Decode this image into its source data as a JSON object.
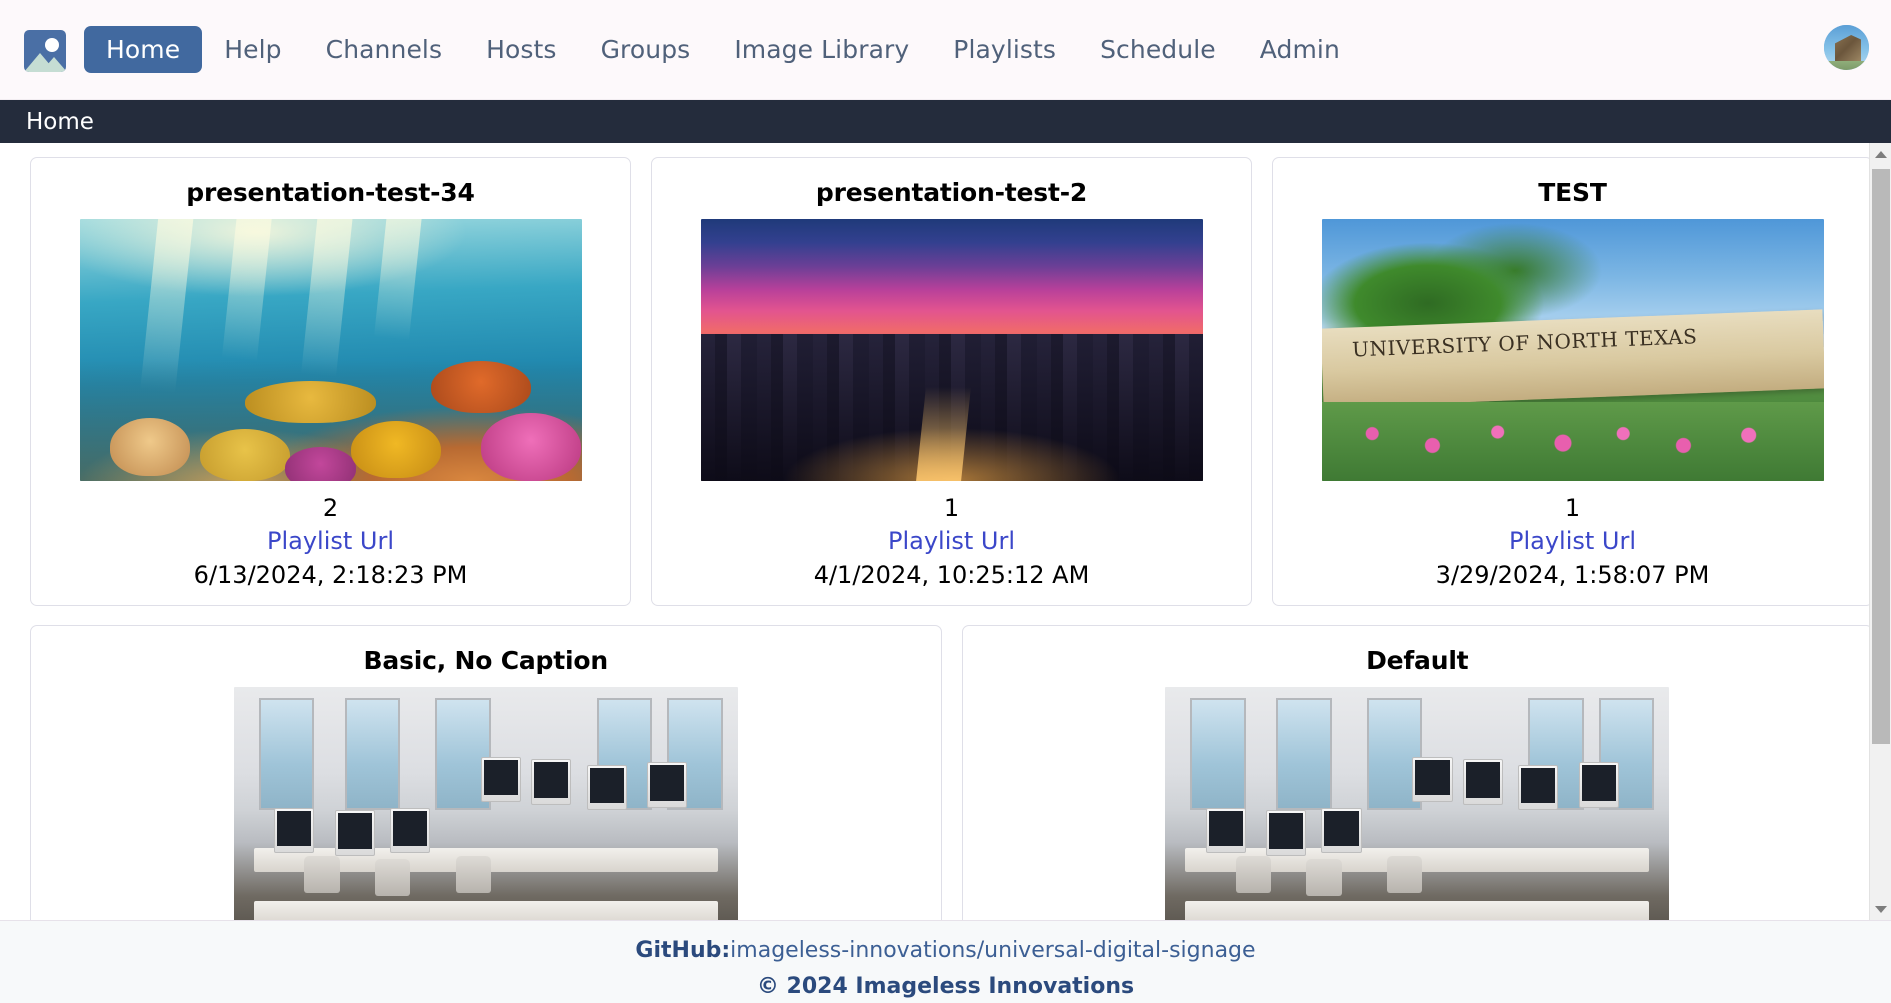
{
  "app": {
    "logo_icon": "image-placeholder-icon",
    "accent_color": "#41699f",
    "breadcrumb_bar_color": "#242c3c",
    "link_color": "#3b47c9"
  },
  "navbar": {
    "items": [
      {
        "label": "Home",
        "active": true
      },
      {
        "label": "Help",
        "active": false
      },
      {
        "label": "Channels",
        "active": false
      },
      {
        "label": "Hosts",
        "active": false
      },
      {
        "label": "Groups",
        "active": false
      },
      {
        "label": "Image Library",
        "active": false
      },
      {
        "label": "Playlists",
        "active": false
      },
      {
        "label": "Schedule",
        "active": false
      },
      {
        "label": "Admin",
        "active": false
      }
    ],
    "avatar_icon": "user-avatar-building-photo"
  },
  "breadcrumb": {
    "current": "Home"
  },
  "cards": [
    {
      "title": "presentation-test-34",
      "image_alt": "coral-reef-underwater-photo",
      "count": "2",
      "link_label": "Playlist Url",
      "date": "6/13/2024, 2:18:23 PM"
    },
    {
      "title": "presentation-test-2",
      "image_alt": "city-skyline-sunset-photo",
      "count": "1",
      "link_label": "Playlist Url",
      "date": "4/1/2024, 10:25:12 AM"
    },
    {
      "title": "TEST",
      "image_alt": "university-of-north-texas-sign-photo",
      "sign_text": "UNIVERSITY OF NORTH TEXAS",
      "count": "1",
      "link_label": "Playlist Url",
      "date": "3/29/2024, 1:58:07 PM"
    },
    {
      "title": "Basic, No Caption",
      "image_alt": "computer-lab-imacs-photo"
    },
    {
      "title": "Default",
      "image_alt": "computer-lab-imacs-photo"
    }
  ],
  "footer": {
    "github_label": "GitHub:",
    "github_repo": "imageless-innovations/universal-digital-signage",
    "copyright": "© 2024 Imageless Innovations"
  },
  "scrollbar": {
    "up_icon": "chevron-up-icon",
    "down_icon": "chevron-down-icon"
  }
}
